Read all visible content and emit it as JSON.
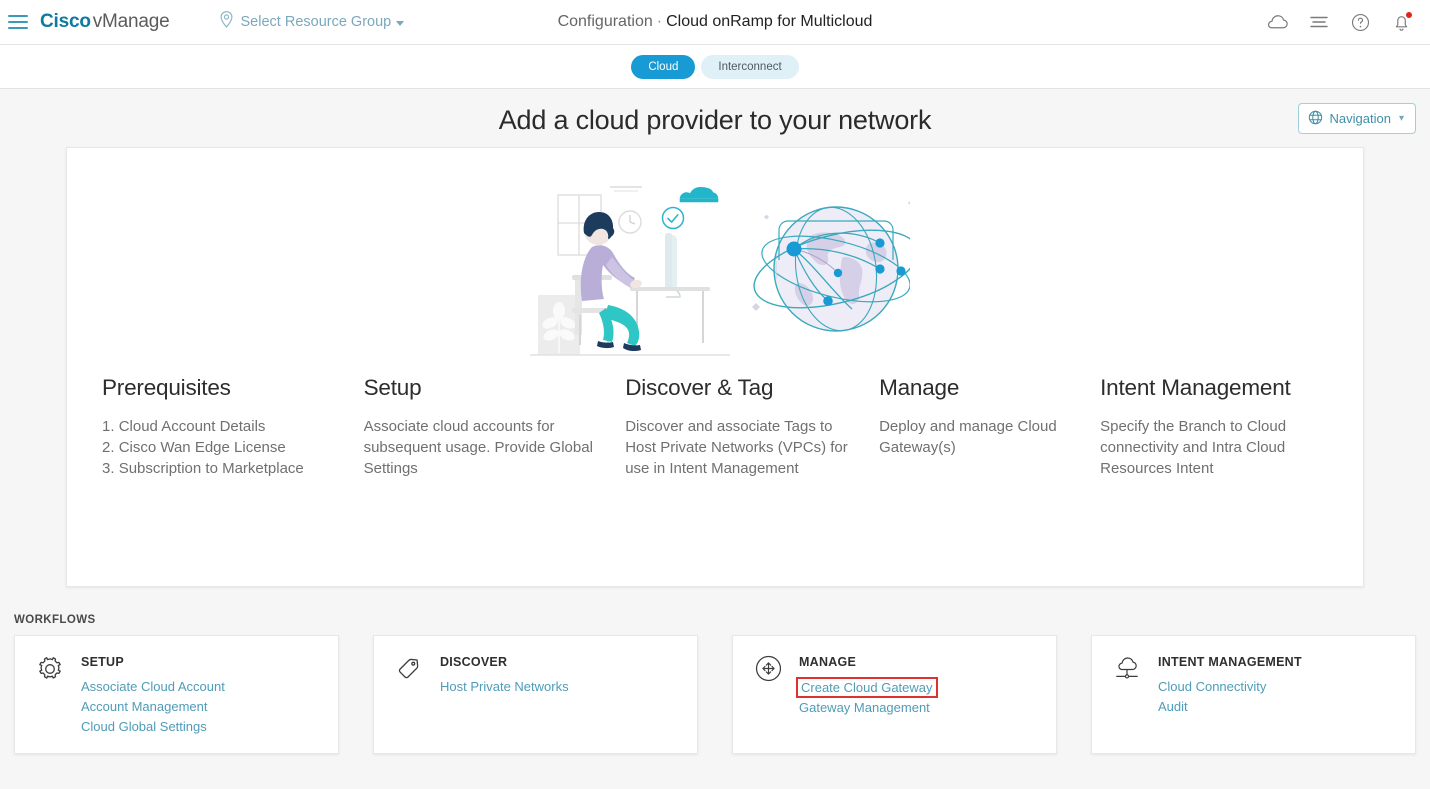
{
  "topbar": {
    "menu_icon": "hamburger-icon",
    "brand_cisco": "Cisco",
    "brand_product": "vManage",
    "resource_group_label": "Select Resource Group",
    "resource_group_icon": "map-pin-icon",
    "breadcrumb_parent": "Configuration",
    "breadcrumb_separator": "·",
    "breadcrumb_current": "Cloud onRamp for Multicloud",
    "icons": [
      {
        "name": "cloud-icon"
      },
      {
        "name": "list-icon"
      },
      {
        "name": "help-icon"
      },
      {
        "name": "notifications-bell-icon",
        "badge": true
      }
    ],
    "notification_badge_color": "#e2231a"
  },
  "tabs": [
    {
      "label": "Cloud",
      "active": true
    },
    {
      "label": "Interconnect",
      "active": false
    }
  ],
  "main": {
    "heading": "Add a cloud provider to your network",
    "navigation_button": {
      "label": "Navigation",
      "icon": "globe-icon",
      "caret": "chevron-down-icon"
    },
    "illustration": "person-at-desk-with-globe-illustration",
    "columns": [
      {
        "title": "Prerequisites",
        "list": [
          "Cloud Account Details",
          "Cisco Wan Edge License",
          "Subscription to Marketplace"
        ]
      },
      {
        "title": "Setup",
        "text": "Associate cloud accounts for subsequent usage. Provide Global Settings"
      },
      {
        "title": "Discover & Tag",
        "text": "Discover and associate Tags to Host Private Networks (VPCs) for use in Intent Management"
      },
      {
        "title": "Manage",
        "text": "Deploy and manage Cloud Gateway(s)"
      },
      {
        "title": "Intent Management",
        "text": "Specify the Branch to Cloud connectivity and Intra Cloud Resources Intent"
      }
    ]
  },
  "workflows": {
    "label": "WORKFLOWS",
    "cards": [
      {
        "title": "SETUP",
        "icon": "gear-icon",
        "links": [
          {
            "label": "Associate Cloud Account",
            "highlighted": false
          },
          {
            "label": "Account Management",
            "highlighted": false
          },
          {
            "label": "Cloud Global Settings",
            "highlighted": false
          }
        ]
      },
      {
        "title": "DISCOVER",
        "icon": "tag-icon",
        "links": [
          {
            "label": "Host Private Networks",
            "highlighted": false
          }
        ]
      },
      {
        "title": "MANAGE",
        "icon": "four-arrows-circle-icon",
        "links": [
          {
            "label": "Create Cloud Gateway",
            "highlighted": true
          },
          {
            "label": "Gateway Management",
            "highlighted": false
          }
        ]
      },
      {
        "title": "INTENT MANAGEMENT",
        "icon": "cloud-connect-icon",
        "links": [
          {
            "label": "Cloud Connectivity",
            "highlighted": false
          },
          {
            "label": "Audit",
            "highlighted": false
          }
        ]
      }
    ]
  },
  "colors": {
    "brand_teal": "#0d7aa0",
    "active_tab": "#189ad4",
    "inactive_tab": "#dff0f7",
    "link": "#4f9cb8",
    "highlight_border": "#e03131",
    "page_background": "#f6f6f6"
  }
}
